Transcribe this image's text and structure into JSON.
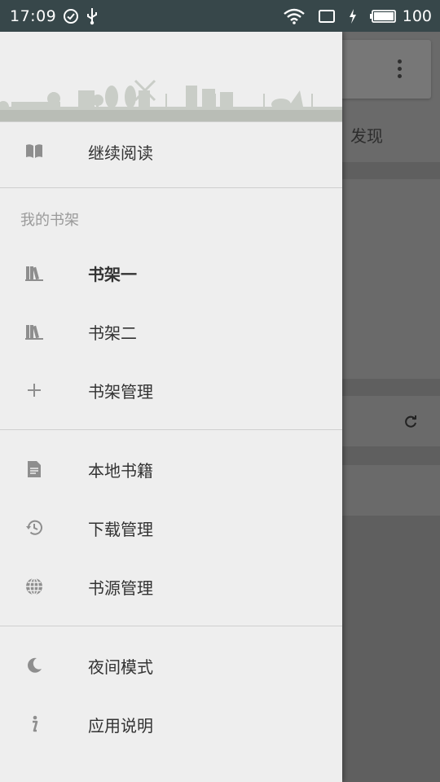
{
  "status_bar": {
    "time": "17:09",
    "battery_level": "100",
    "icons": [
      "check-circle-icon",
      "usb-icon",
      "wifi-icon",
      "cast-icon",
      "charging-icon",
      "battery-icon"
    ]
  },
  "background_app": {
    "tab_label": "发现",
    "icons": [
      "more-vert-icon",
      "refresh-icon"
    ]
  },
  "drawer": {
    "continue_reading": {
      "label": "继续阅读",
      "icon": "book-open-icon"
    },
    "bookshelf_section": {
      "title": "我的书架",
      "items": [
        {
          "label": "书架一",
          "icon": "books-icon",
          "selected": true
        },
        {
          "label": "书架二",
          "icon": "books-icon",
          "selected": false
        },
        {
          "label": "书架管理",
          "icon": "plus-icon",
          "selected": false
        }
      ]
    },
    "tools_section": {
      "items": [
        {
          "label": "本地书籍",
          "icon": "document-icon"
        },
        {
          "label": "下载管理",
          "icon": "history-icon"
        },
        {
          "label": "书源管理",
          "icon": "globe-icon"
        }
      ]
    },
    "misc_section": {
      "items": [
        {
          "label": "夜间模式",
          "icon": "moon-icon"
        },
        {
          "label": "应用说明",
          "icon": "info-icon"
        }
      ]
    }
  },
  "colors": {
    "status_bar": "#37474a",
    "drawer_bg": "#eeeeee",
    "icon_gray": "#8e8e8e",
    "text_dark": "#333333",
    "section_title": "#9a9a9a"
  }
}
